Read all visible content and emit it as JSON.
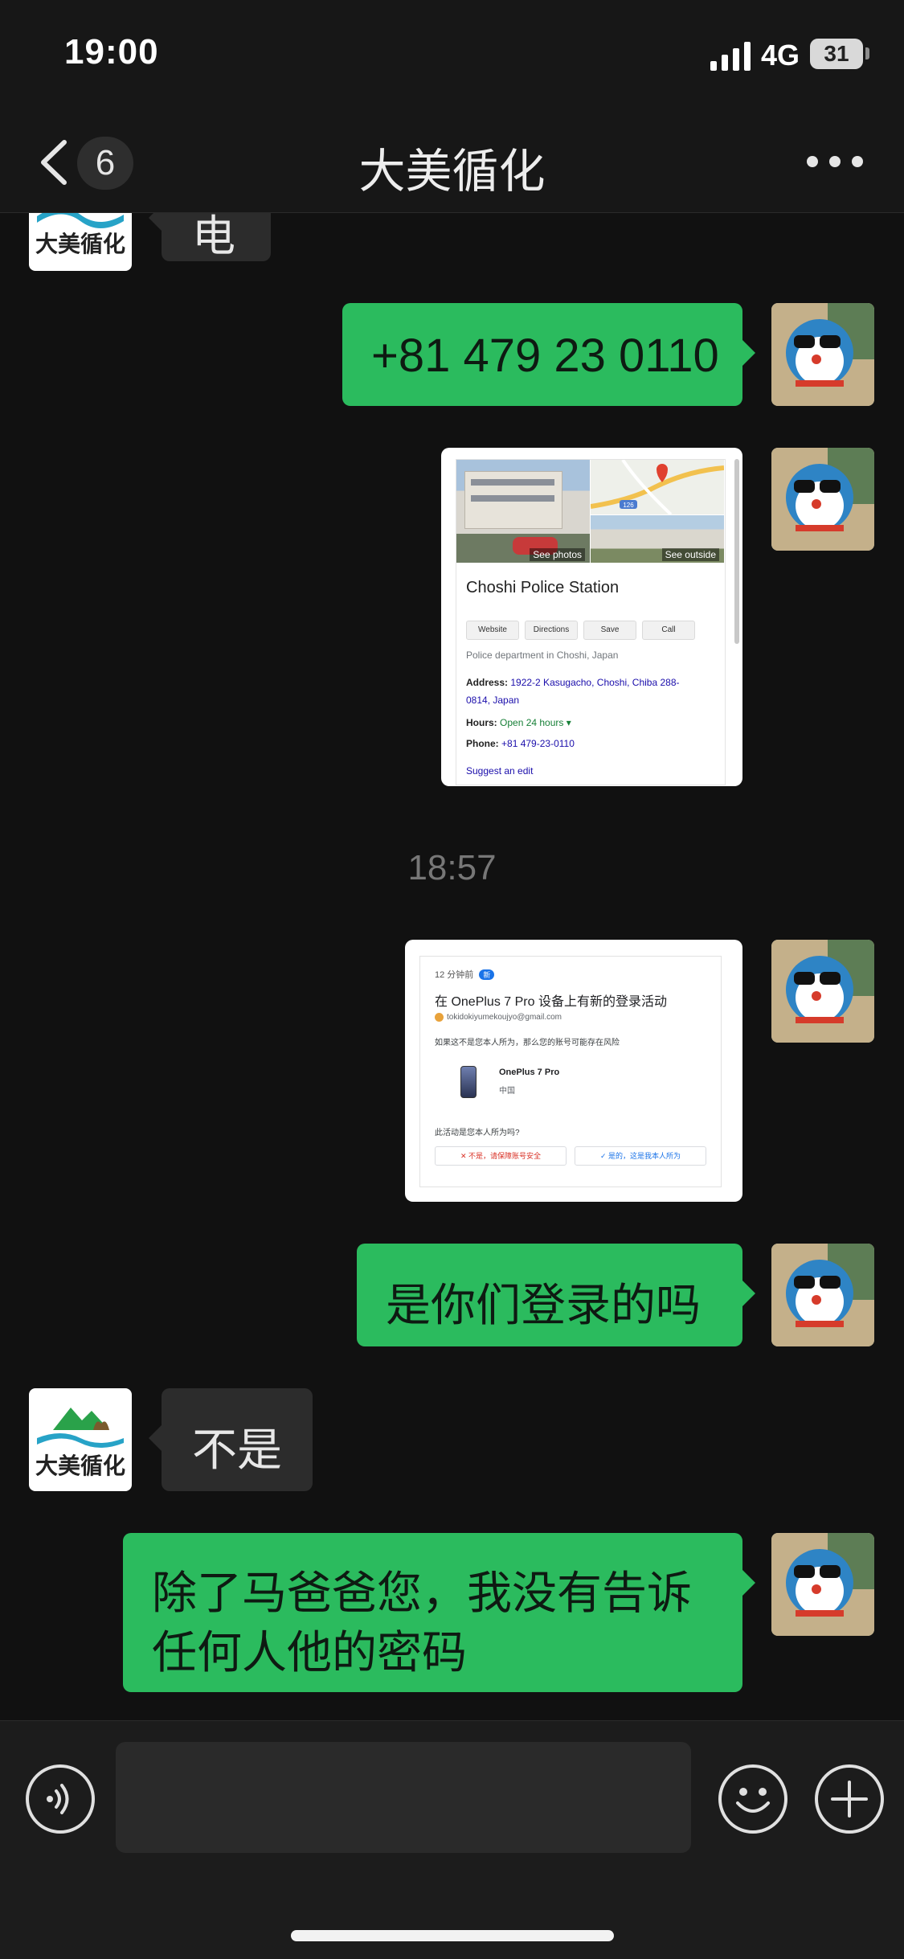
{
  "status_bar": {
    "time": "19:00",
    "network": "4G",
    "battery": "31"
  },
  "nav": {
    "back_count": "6",
    "title": "大美循化"
  },
  "messages": {
    "m0_text": "电",
    "m1_text": "+81 479 23 0110",
    "m2_card": {
      "place": "Choshi Police Station",
      "see_photos": "See photos",
      "see_outside": "See outside",
      "buttons": [
        "Website",
        "Directions",
        "Save",
        "Call"
      ],
      "category": "Police department in Choshi, Japan",
      "address_label": "Address:",
      "address_value_1": "1922-2 Kasugacho, Choshi, Chiba 288-",
      "address_value_2": "0814, Japan",
      "hours_label": "Hours:",
      "hours_value": "Open 24 hours ▾",
      "phone_label": "Phone:",
      "phone_value": "+81 479-23-0110",
      "suggest": "Suggest an edit",
      "road_label": "126"
    },
    "timestamp": "18:57",
    "m3_card": {
      "ago": "12 分钟前",
      "new_badge": "新",
      "headline": "在 OnePlus 7 Pro 设备上有新的登录活动",
      "email": "tokidokiyumekoujyo@gmail.com",
      "warning": "如果这不是您本人所为，那么您的账号可能存在风险",
      "device_name": "OnePlus 7 Pro",
      "device_location": "中国",
      "question": "此活动是您本人所为吗?",
      "deny": "✕  不是，请保障账号安全",
      "confirm": "✓  是的，这是我本人所为"
    },
    "m4_text": "是你们登录的吗",
    "m5_text": "不是",
    "m6_line1": "除了马爸爸您，我没有告诉",
    "m6_line2": "任何人他的密码"
  },
  "avatars": {
    "brand_text": "大美循化"
  },
  "input": {
    "voice_icon": "voice-icon",
    "emoji_icon": "emoji-icon",
    "plus_icon": "plus-icon"
  },
  "colors": {
    "outgoing_bubble": "#2bbb5e",
    "incoming_bubble": "#2c2c2c",
    "background": "#111111"
  }
}
